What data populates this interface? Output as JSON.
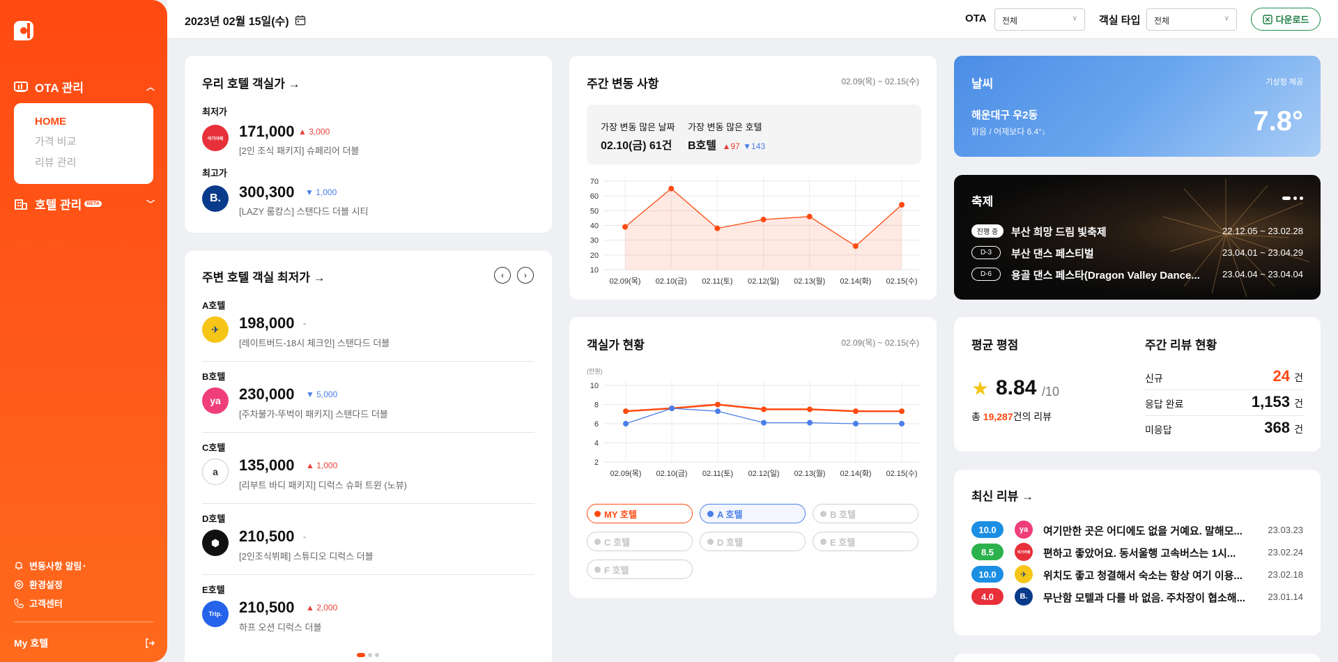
{
  "sidebar": {
    "ota_label": "OTA 관리",
    "menu": [
      "HOME",
      "가격 비교",
      "리뷰 관리"
    ],
    "hotel_label": "호텔 관리",
    "beta": "BETA",
    "bottom": [
      "변동사항 알림",
      "환경설정",
      "고객센터"
    ],
    "my_hotel": "My 호텔"
  },
  "topbar": {
    "date": "2023년 02월 15일(수)",
    "ota_label": "OTA",
    "ota_value": "전체",
    "room_label": "객실 타입",
    "room_value": "전체",
    "download": "다운로드"
  },
  "our_price": {
    "title": "우리 호텔 객실가",
    "low_label": "최저가",
    "low_ota": "여기어때",
    "low_price": "171,000",
    "low_delta": "3,000",
    "low_desc": "[2인 조식 패키지] 슈페리어 더블",
    "high_label": "최고가",
    "high_ota": "B.",
    "high_price": "300,300",
    "high_delta": "1,000",
    "high_desc": "[LAZY 룸캉스] 스탠다드 더블 시티"
  },
  "nearby": {
    "title": "주변 호텔 객실 최저가",
    "hotels": [
      {
        "name": "A호텔",
        "price": "198,000",
        "delta": "-",
        "desc": "[레이트버드-18시 체크인] 스탠다드 더블",
        "dir": "none",
        "icon": "✈",
        "color": "#f5c518"
      },
      {
        "name": "B호텔",
        "price": "230,000",
        "delta": "5,000",
        "desc": "[주차불가-뚜벅이 패키지] 스탠다드 더블",
        "dir": "down",
        "icon": "ya",
        "color": "#ef3e7a"
      },
      {
        "name": "C호텔",
        "price": "135,000",
        "delta": "1,000",
        "desc": "[리부트 바디 패키지] 디럭스 슈퍼 트윈 (노뷰)",
        "dir": "up",
        "icon": "a",
        "color": "#ffffff"
      },
      {
        "name": "D호텔",
        "price": "210,500",
        "delta": "-",
        "desc": "[2인조식뷔페] 스튜디오 디럭스 더블",
        "dir": "none",
        "icon": "⬢",
        "color": "#111111"
      },
      {
        "name": "E호텔",
        "price": "210,500",
        "delta": "2,000",
        "desc": "하프 오션 디럭스 더블",
        "dir": "up",
        "icon": "Trip.",
        "color": "#2563eb"
      }
    ]
  },
  "weekly": {
    "title": "주간 변동 사항",
    "range": "02.09(목) ~ 02.15(수)",
    "most_day_label": "가장 변동 많은 날짜",
    "most_day": "02.10(금) 61건",
    "most_hotel_label": "가장 변동 많은 호텔",
    "most_hotel": "B호텔",
    "up": "97",
    "down": "143"
  },
  "room_status": {
    "title": "객실가 현황",
    "range": "02.09(목) ~ 02.15(수)",
    "unit": "(만원)",
    "legend": [
      {
        "label": "MY 호텔",
        "color": "#ff4a12",
        "active": true
      },
      {
        "label": "A 호텔",
        "color": "#4a7ee8",
        "active": true
      },
      {
        "label": "B 호텔",
        "color": "#cccccc",
        "active": false
      },
      {
        "label": "C 호텔",
        "color": "#cccccc",
        "active": false
      },
      {
        "label": "D 호텔",
        "color": "#cccccc",
        "active": false
      },
      {
        "label": "E 호텔",
        "color": "#cccccc",
        "active": false
      },
      {
        "label": "F 호텔",
        "color": "#cccccc",
        "active": false
      }
    ]
  },
  "weather": {
    "title": "날씨",
    "source": "기상청 제공",
    "location": "해운대구 우2동",
    "desc": "맑음 / 어제보다 6.4°↓",
    "temp": "7.8°"
  },
  "festival": {
    "title": "축제",
    "items": [
      {
        "badge": "진행 중",
        "name": "부산 희망 드림 빛축제",
        "dates": "22.12.05 ~ 23.02.28",
        "filled": true
      },
      {
        "badge": "D-3",
        "name": "부산 댄스 페스티벌",
        "dates": "23.04.01 ~ 23.04.29",
        "filled": false
      },
      {
        "badge": "D-6",
        "name": "용골 댄스 페스타(Dragon Valley Dance...",
        "dates": "23.04.04 ~ 23.04.04",
        "filled": false
      }
    ]
  },
  "rating": {
    "title": "평균 평점",
    "score": "8.84",
    "max": "/10",
    "total_prefix": "총 ",
    "total_count": "19,287",
    "total_suffix": "건의 리뷰"
  },
  "weekly_review": {
    "title": "주간 리뷰 현황",
    "rows": [
      {
        "label": "신규",
        "value": "24",
        "unit": "건",
        "highlight": true
      },
      {
        "label": "응답 완료",
        "value": "1,153",
        "unit": "건",
        "highlight": false
      },
      {
        "label": "미응답",
        "value": "368",
        "unit": "건",
        "highlight": false
      }
    ]
  },
  "latest_reviews": {
    "title": "최신 리뷰",
    "items": [
      {
        "score": "10.0",
        "color": "#1a8fe3",
        "icon": "ya",
        "icon_color": "#ef3e7a",
        "text": "여기만한 곳은 어디에도 없을 거예요. 말해모...",
        "date": "23.03.23"
      },
      {
        "score": "8.5",
        "color": "#2bb24c",
        "icon": "여기어때",
        "icon_color": "#e8303a",
        "text": "편하고 좋았어요. 동서울행 고속버스는 1시...",
        "date": "23.02.24"
      },
      {
        "score": "10.0",
        "color": "#1a8fe3",
        "icon": "✈",
        "icon_color": "#f5c518",
        "text": "위치도 좋고 청결해서 숙소는 항상 여기 이용...",
        "date": "23.02.18"
      },
      {
        "score": "4.0",
        "color": "#e8303a",
        "icon": "B.",
        "icon_color": "#0a3a8a",
        "text": "무난함 모텔과 다를 바 없음. 주차장이 협소해...",
        "date": "23.01.14"
      }
    ]
  },
  "chart_data": [
    {
      "type": "area",
      "categories": [
        "02.09(목)",
        "02.10(금)",
        "02.11(토)",
        "02.12(일)",
        "02.13(월)",
        "02.14(화)",
        "02.15(수)"
      ],
      "values": [
        39,
        65,
        38,
        44,
        46,
        26,
        54
      ],
      "ylim": [
        10,
        70
      ],
      "yticks": [
        10,
        20,
        30,
        40,
        50,
        60,
        70
      ],
      "color": "#ff4a12"
    },
    {
      "type": "line",
      "categories": [
        "02.09(목)",
        "02.10(금)",
        "02.11(토)",
        "02.12(일)",
        "02.13(월)",
        "02.14(화)",
        "02.15(수)"
      ],
      "ylabel": "(만원)",
      "ylim": [
        2,
        10
      ],
      "yticks": [
        2,
        4,
        6,
        8,
        10
      ],
      "series": [
        {
          "name": "MY 호텔",
          "color": "#ff4a12",
          "values": [
            7.3,
            7.6,
            8.0,
            7.5,
            7.5,
            7.3,
            7.3
          ]
        },
        {
          "name": "A 호텔",
          "color": "#4a7ee8",
          "values": [
            6.0,
            7.6,
            7.3,
            6.1,
            6.1,
            6.0,
            6.0
          ]
        }
      ]
    }
  ]
}
